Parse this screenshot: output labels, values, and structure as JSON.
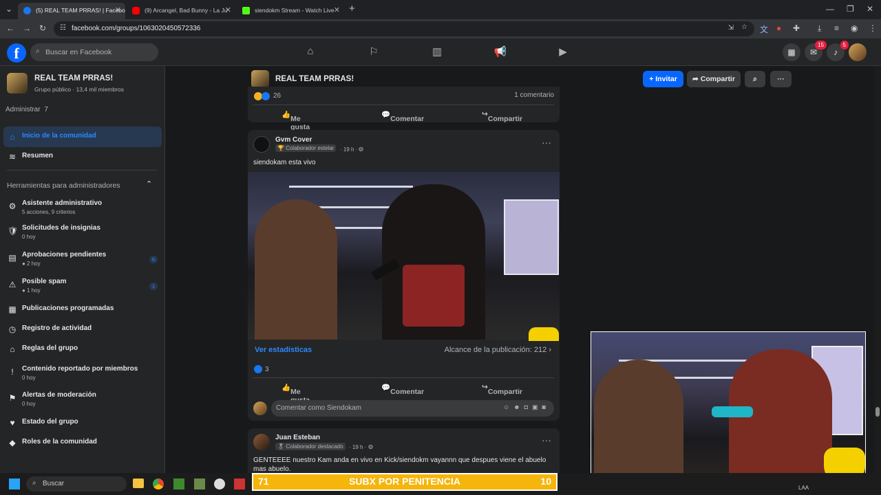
{
  "browser": {
    "tabs": [
      {
        "title": "(5) REAL TEAM PRRAS! | Facebo",
        "active": true,
        "color": "#1877f2"
      },
      {
        "title": "(9) Arcangel, Bad Bunny - La Ju",
        "active": false,
        "color": "#ff0000"
      },
      {
        "title": "siendokm Stream - Watch Live",
        "active": false,
        "color": "#53fc18"
      }
    ],
    "new_tab": "+",
    "url": "facebook.com/groups/1063020450572336"
  },
  "fb": {
    "search_placeholder": "Buscar en Facebook",
    "messenger_badge": "15",
    "notif_badge": "5"
  },
  "group": {
    "name": "REAL TEAM PRRAS!",
    "meta": "Grupo público · 13,4 mil miembros",
    "invite": "Invitar",
    "share": "Compartir",
    "more": "···"
  },
  "sidebar": {
    "admin_label": "Administrar",
    "admin_count": "7",
    "home": "Inicio de la comunidad",
    "summary": "Resumen",
    "tools_title": "Herramientas para administradores",
    "tools": [
      {
        "label": "Asistente administrativo",
        "sub": "5 acciones, 9 criterios",
        "icon": "⚙"
      },
      {
        "label": "Solicitudes de insignias",
        "sub": "0 hoy",
        "icon": "🛡"
      },
      {
        "label": "Aprobaciones pendientes",
        "sub": "● 2 hoy",
        "count": "6",
        "icon": "▤"
      },
      {
        "label": "Posible spam",
        "sub": "● 1 hoy",
        "count": "1",
        "icon": "⚠"
      },
      {
        "label": "Publicaciones programadas",
        "sub": "",
        "icon": "▦"
      },
      {
        "label": "Registro de actividad",
        "sub": "",
        "icon": "◷"
      },
      {
        "label": "Reglas del grupo",
        "sub": "",
        "icon": "⌂"
      },
      {
        "label": "Contenido reportado por miembros",
        "sub": "0 hoy",
        "icon": "!"
      },
      {
        "label": "Alertas de moderación",
        "sub": "0 hoy",
        "icon": "⚑"
      },
      {
        "label": "Estado del grupo",
        "sub": "",
        "icon": "♥"
      },
      {
        "label": "Roles de la comunidad",
        "sub": "",
        "icon": "◆"
      }
    ]
  },
  "posts": {
    "prev": {
      "reactions": "26",
      "comments": "1 comentario"
    },
    "actions": {
      "like": "Me gusta",
      "comment": "Comentar",
      "share": "Compartir"
    },
    "p1": {
      "author": "Gvm Cover",
      "badge": "Colaborador estelar",
      "time": "· 19 h ·",
      "text": "siendokam esta vivo",
      "stats_link": "Ver estadísticas",
      "reach": "Alcance de la publicación: 212",
      "reactions": "3",
      "comment_placeholder": "Comentar como Siendokam"
    },
    "p2": {
      "author": "Juan Esteban",
      "badge": "Colaborador destacado",
      "time": "· 19 h ·",
      "text": "GENTEEEE nuestro Kam anda en vivo en Kick/siendokm vayannn que despues viene el abuelo mas abuelo."
    }
  },
  "banner": {
    "left": "71",
    "center": "SUBX POR PENITENCIA",
    "right": "10"
  },
  "taskbar": {
    "search": "Buscar",
    "tray": "LAA"
  }
}
